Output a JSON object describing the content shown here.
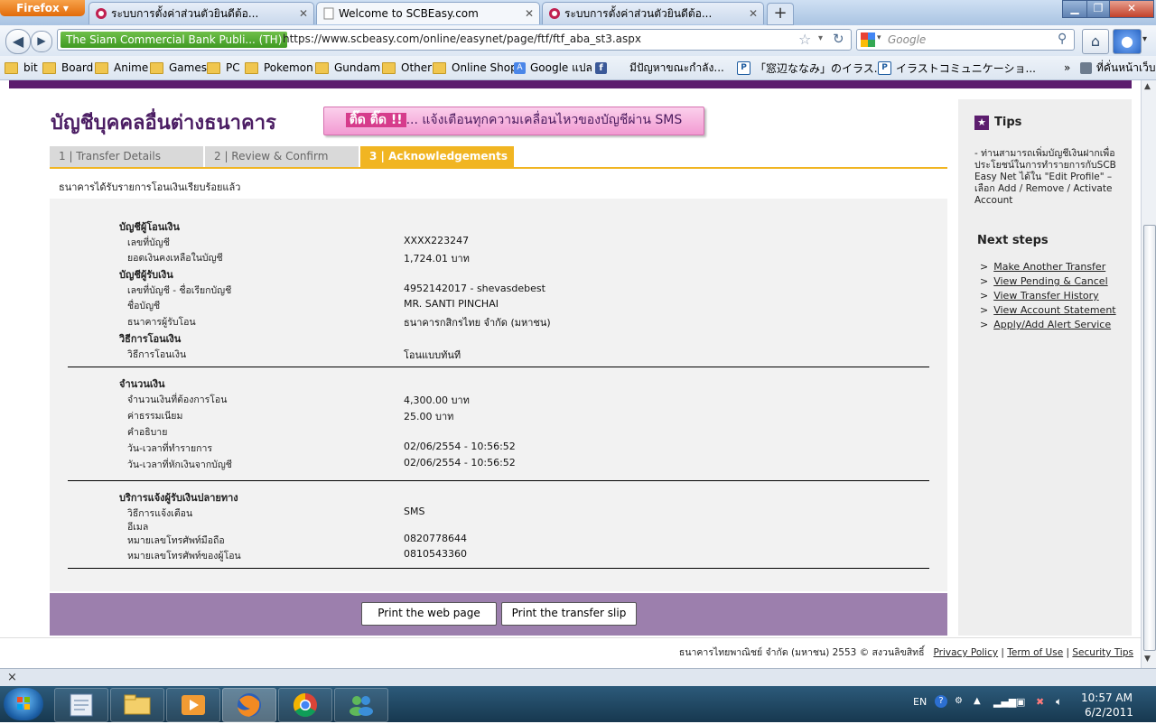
{
  "browser": {
    "menu_button": "Firefox",
    "tabs": [
      {
        "title": "ระบบการตั้งค่าส่วนตัวยินดีต้อ...",
        "active": false
      },
      {
        "title": "Welcome to SCBEasy.com",
        "active": true
      },
      {
        "title": "ระบบการตั้งค่าส่วนตัวยินดีต้อ...",
        "active": false
      }
    ],
    "new_tab": "+",
    "identity": "The Siam Commercial Bank Publi... (TH)",
    "url": "https://www.scbeasy.com/online/easynet/page/ftf/ftf_aba_st3.aspx",
    "search_placeholder": "Google",
    "bookmarks": [
      {
        "label": "bit",
        "icon": "folder-icon"
      },
      {
        "label": "Board",
        "icon": "folder-icon"
      },
      {
        "label": "Anime",
        "icon": "folder-icon"
      },
      {
        "label": "Games",
        "icon": "folder-icon"
      },
      {
        "label": "PC",
        "icon": "folder-icon"
      },
      {
        "label": "Pokemon",
        "icon": "folder-icon"
      },
      {
        "label": "Gundam",
        "icon": "folder-icon"
      },
      {
        "label": "Other",
        "icon": "folder-icon"
      },
      {
        "label": "Online Shop",
        "icon": "folder-icon"
      },
      {
        "label": "Google แปล",
        "icon": "google-translate-icon"
      },
      {
        "label": "",
        "icon": "facebook-icon"
      },
      {
        "label": "มีปัญหาขณะกำลัง...",
        "icon": "none"
      },
      {
        "label": "「窓辺ななみ」のイラス...",
        "icon": "pixiv-icon"
      },
      {
        "label": "イラストコミュニケーショ...",
        "icon": "pixiv-icon"
      }
    ],
    "bookmarks_overflow": "»",
    "bookmarks_home": "ที่คั่นหน้าเว็บ",
    "status_close": "×"
  },
  "page": {
    "heading": "บัญชีบุคคลอื่นต่างธนาคาร",
    "banner": {
      "highlight": "ติ๊ด ติ๊ด !!",
      "text": "... แจ้งเตือนทุกความเคลื่อนไหวของบัญชีผ่าน SMS"
    },
    "steps": [
      "1 | Transfer Details",
      "2 | Review & Confirm",
      "3 | Acknowledgements"
    ],
    "active_step": 3,
    "ack_message": "ธนาคารได้รับรายการโอนเงินเรียบร้อยแล้ว",
    "from_section": {
      "heading": "บัญชีผู้โอนเงิน",
      "account_label": "เลขที่บัญชี",
      "account_value": "XXXX223247",
      "balance_label": "ยอดเงินคงเหลือในบัญชี",
      "balance_value": "1,724.01 บาท"
    },
    "to_section": {
      "heading": "บัญชีผู้รับเงิน",
      "account_label": "เลขที่บัญชี - ชื่อเรียกบัญชี",
      "account_value": "4952142017 - shevasdebest",
      "name_label": "ชื่อบัญชี",
      "name_value": "MR. SANTI PINCHAI",
      "bank_label": "ธนาคารผู้รับโอน",
      "bank_value": "ธนาคารกสิกรไทย จำกัด (มหาชน)"
    },
    "method_section": {
      "heading": "วิธีการโอนเงิน",
      "method_label": "วิธีการโอนเงิน",
      "method_value": "โอนแบบทันที"
    },
    "amount_section": {
      "heading": "จำนวนเงิน",
      "amount_label": "จำนวนเงินที่ต้องการโอน",
      "amount_value": "4,300.00 บาท",
      "fee_label": "ค่าธรรมเนียม",
      "fee_value": "25.00  บาท",
      "desc_label": "คำอธิบาย",
      "txn_time_label": "วัน-เวลาที่ทำรายการ",
      "txn_time_value": "02/06/2554 - 10:56:52",
      "debit_time_label": "วัน-เวลาที่หักเงินจากบัญชี",
      "debit_time_value": "02/06/2554 - 10:56:52"
    },
    "notify_section": {
      "heading": "บริการแจ้งผู้รับเงินปลายทาง",
      "method_label": "วิธีการแจ้งเตือน",
      "method_value": "SMS",
      "email_label": "อีเมล",
      "mobile_label": "หมายเลขโทรศัพท์มือถือ",
      "mobile_value": "0820778644",
      "sender_label": "หมายเลขโทรศัพท์ของผู้โอน",
      "sender_value": "0810543360"
    },
    "buttons": {
      "print_page": "Print the web page",
      "print_slip": "Print the transfer slip"
    },
    "sidebar": {
      "tips_title": "Tips",
      "tips_text": "- ท่านสามารถเพิ่มบัญชีเงินฝากเพื่อประโยชน์ในการทำรายการกับSCB Easy Net ได้ใน \"Edit Profile\" – เลือก Add / Remove / Activate Account",
      "next_title": "Next steps",
      "links": [
        "Make Another Transfer",
        "View Pending & Cancel",
        "View Transfer History",
        "View Account Statement",
        "Apply/Add Alert Service"
      ]
    },
    "footer": {
      "copyright": "ธนาคารไทยพาณิชย์ จำกัด (มหาชน) 2553 © สงวนลิขสิทธิ์",
      "links": [
        "Privacy Policy",
        "Term of Use",
        "Security Tips"
      ]
    }
  },
  "taskbar": {
    "lang": "EN",
    "time": "10:57 AM",
    "date": "6/2/2011"
  }
}
